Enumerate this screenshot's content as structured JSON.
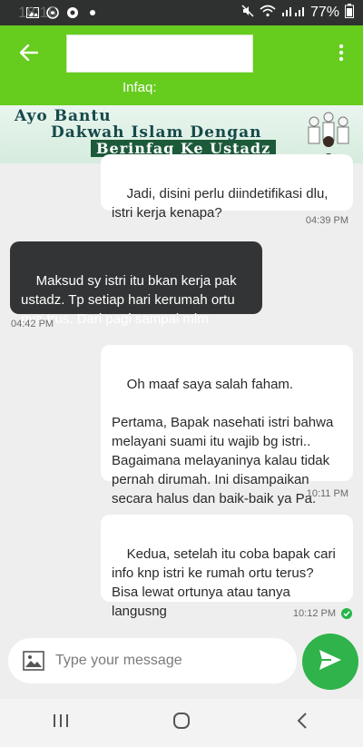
{
  "status_bar": {
    "time": "18:16",
    "battery": "77%",
    "icons": [
      "gallery-icon",
      "whatsapp-icon",
      "chrome-icon",
      "dot-icon"
    ],
    "right_icons": [
      "mute-icon",
      "wifi-icon",
      "signal-icon",
      "battery-icon"
    ]
  },
  "app_bar": {
    "title": "",
    "subtitle": "Infaq:",
    "back_icon": "back-arrow-icon",
    "menu_icon": "more-vert-icon"
  },
  "banner": {
    "line1": "Ayo Bantu",
    "line2": "Dakwah Islam Dengan",
    "line3": "Berinfaq Ke Ustadz"
  },
  "messages": [
    {
      "direction": "out",
      "text": "Jadi, disini perlu diindetifikasi dlu,\nistri kerja kenapa?",
      "time": "04:39 PM"
    },
    {
      "direction": "in",
      "text": "Maksud sy istri itu bkan kerja pak\nustadz. Tp setiap hari kerumah ortu\nnya trus. Dari pagi sampai mlm",
      "time": "04:42 PM"
    },
    {
      "direction": "out",
      "text": "Oh maaf saya salah faham.\n\nPertama, Bapak nasehati istri bahwa\nmelayani suami itu wajib bg istri..\nBagaimana melayaninya kalau tidak\npernah dirumah. Ini disampaikan\nsecara halus dan baik-baik ya Pa.",
      "time": "10:11 PM"
    },
    {
      "direction": "out",
      "text": "Kedua, setelah itu coba bapak cari\ninfo knp istri ke rumah ortu terus?\nBisa lewat ortunya atau tanya\nlangusng",
      "time": "10:12 PM",
      "read": true
    }
  ],
  "composer": {
    "placeholder": "Type your message",
    "attach_icon": "image-icon",
    "send_icon": "send-icon"
  },
  "nav_bar": {
    "icons": [
      "recent-apps-icon",
      "home-icon",
      "back-icon"
    ]
  },
  "colors": {
    "app_bar": "#66cc1e",
    "send_button": "#2fb34a",
    "incoming_bubble": "#333435",
    "outgoing_bubble": "#ffffff",
    "tick": "#25b64a"
  }
}
